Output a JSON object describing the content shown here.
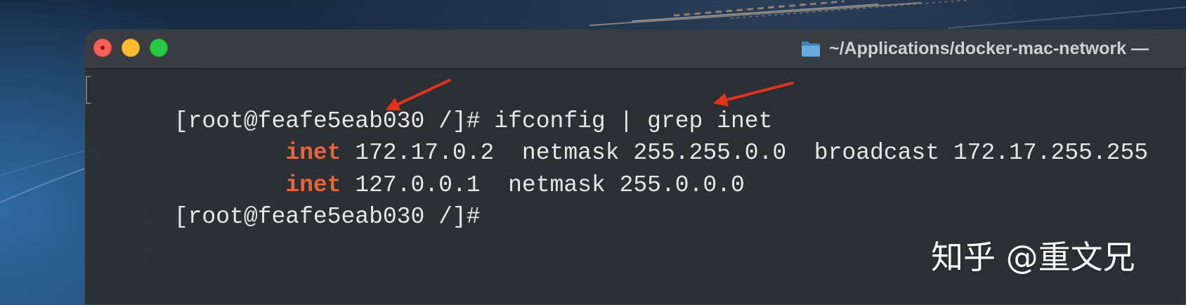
{
  "window": {
    "title": "~/Applications/docker-mac-network —",
    "title_icon": "folder-icon",
    "traffic_lights": {
      "close": "#ff5f57",
      "minimize": "#febc2e",
      "zoom": "#28c840"
    }
  },
  "terminal": {
    "text_color": "#e6e6e6",
    "keyword_color": "#e8643a",
    "lines": [
      {
        "prompt": "[root@feafe5eab030 /]#",
        "command": " ifconfig | grep inet"
      },
      {
        "indent": "        ",
        "keyword": "inet",
        "text": " 172.17.0.2  netmask 255.255.0.0  broadcast 172.17.255.255"
      },
      {
        "indent": "        ",
        "keyword": "inet",
        "text": " 127.0.0.1  netmask 255.0.0.0"
      },
      {
        "prompt": "[root@feafe5eab030 /]#"
      }
    ]
  },
  "annotations": {
    "arrow_color": "#e2311d"
  },
  "watermark": {
    "text": "知乎 @重文兄"
  }
}
